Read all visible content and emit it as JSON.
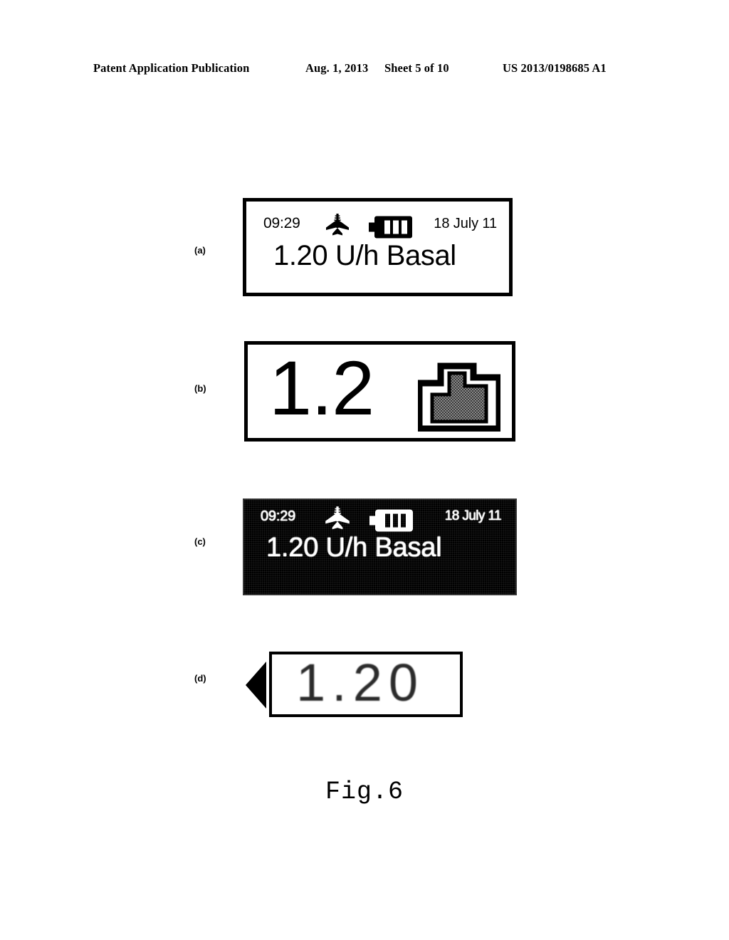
{
  "header": {
    "publication": "Patent Application Publication",
    "date": "Aug. 1, 2013",
    "sheet": "Sheet 5 of 10",
    "patent_number": "US 2013/0198685 A1"
  },
  "figure": {
    "caption": "Fig.6",
    "panels": [
      {
        "label": "(a)",
        "type": "normal-lcd",
        "status": {
          "time": "09:29",
          "date": "18 July 11",
          "icons": [
            "airplane-mode-icon",
            "battery-icon"
          ],
          "battery_bars": 3
        },
        "main_text": "1.20 U/h Basal"
      },
      {
        "label": "(b)",
        "type": "large-value-lcd",
        "value": "1.2",
        "icon": "basal-profile-bar-icon"
      },
      {
        "label": "(c)",
        "type": "inverted-lcd",
        "status": {
          "time": "09:29",
          "date": "18 July 11",
          "icons": [
            "airplane-mode-icon",
            "battery-icon"
          ],
          "battery_bars": 3
        },
        "main_text": "1.20 U/h Basal"
      },
      {
        "label": "(d)",
        "type": "scrolling-lcd",
        "value": "1.20",
        "arrow": "left-arrow-icon"
      }
    ]
  },
  "colors": {
    "ink": "#000000",
    "paper": "#ffffff",
    "inverted_background": "#000000",
    "inverted_ink": "#ffffff"
  }
}
